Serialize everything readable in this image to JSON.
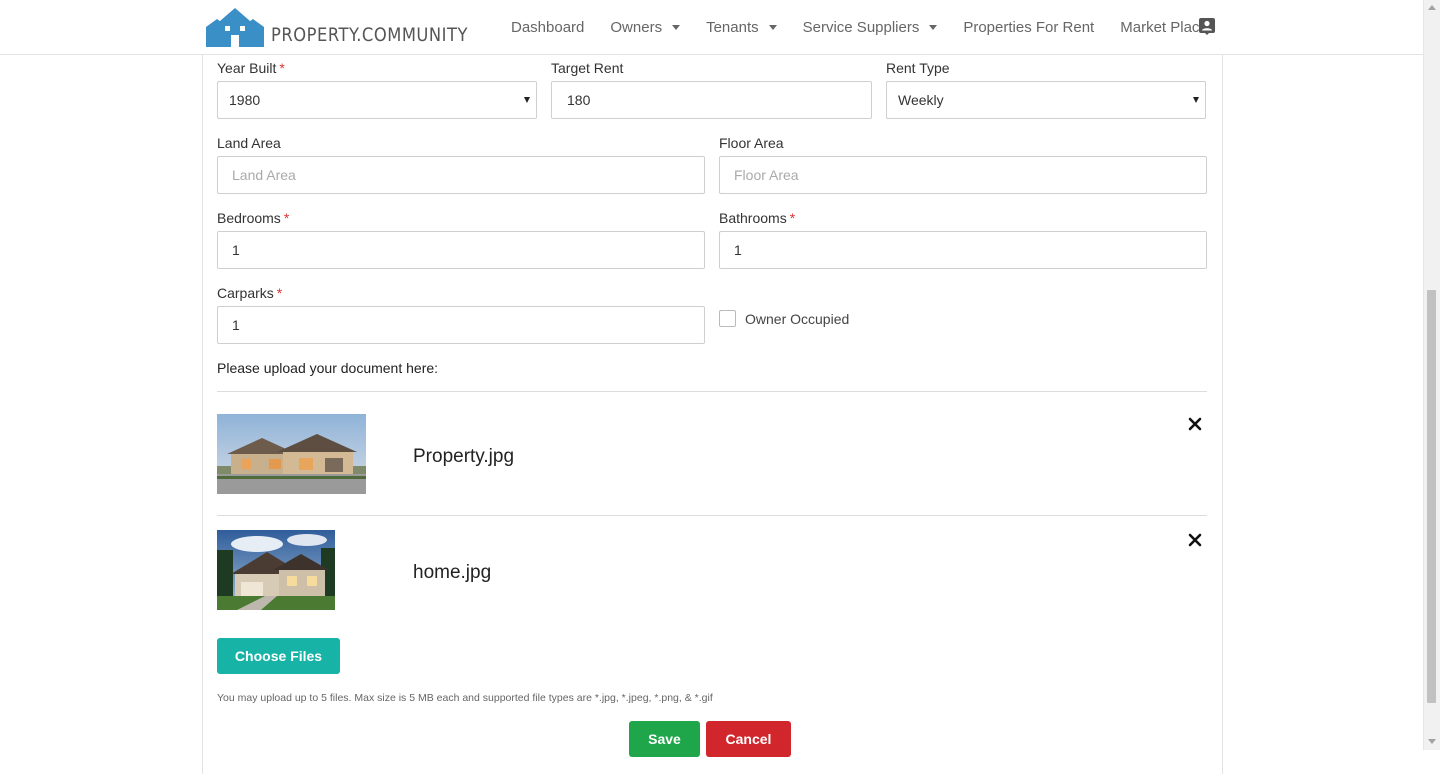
{
  "brand": {
    "logo_text": "PROPERTY.COMMUNITY"
  },
  "nav": {
    "items": [
      {
        "label": "Dashboard"
      },
      {
        "label": "Owners"
      },
      {
        "label": "Tenants"
      },
      {
        "label": "Service Suppliers"
      },
      {
        "label": "Properties For Rent"
      },
      {
        "label": "Market Place"
      }
    ],
    "profile_icon": "contact-card-icon"
  },
  "form": {
    "year_built": {
      "label": "Year Built",
      "required_mark": "*",
      "value": "1980"
    },
    "target_rent": {
      "label": "Target Rent",
      "value": "180"
    },
    "rent_type": {
      "label": "Rent Type",
      "value": "Weekly"
    },
    "land_area": {
      "label": "Land Area",
      "placeholder": "Land Area"
    },
    "floor_area": {
      "label": "Floor Area",
      "placeholder": "Floor Area"
    },
    "bedrooms": {
      "label": "Bedrooms",
      "required_mark": "*",
      "value": "1"
    },
    "bathrooms": {
      "label": "Bathrooms",
      "required_mark": "*",
      "value": "1"
    },
    "carparks": {
      "label": "Carparks",
      "required_mark": "*",
      "value": "1"
    },
    "owner_occupied": {
      "label": "Owner Occupied",
      "checked": false
    }
  },
  "uploads": {
    "heading": "Please upload your document here:",
    "files": [
      {
        "name": "Property.jpg"
      },
      {
        "name": "home.jpg"
      }
    ],
    "choose_label": "Choose Files",
    "help_text": "You may upload up to 5 files. Max size is 5 MB each and supported file types are *.jpg, *.jpeg, *.png, & *.gif"
  },
  "actions": {
    "save_label": "Save",
    "cancel_label": "Cancel"
  },
  "colors": {
    "teal": "#17b3a6",
    "green": "#1fa64a",
    "red": "#d0262c",
    "logo_blue": "#3a8fc7"
  }
}
